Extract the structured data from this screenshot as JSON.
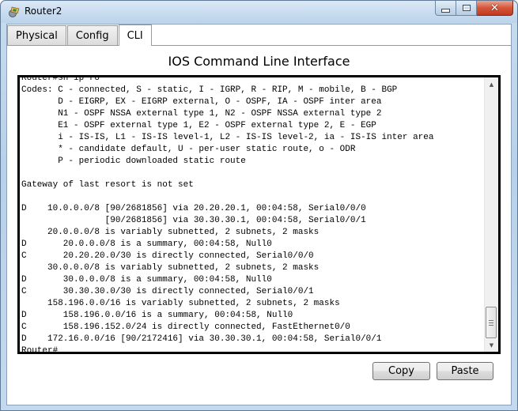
{
  "window": {
    "title": "Router2",
    "icon": "router-device-icon",
    "controls": {
      "minimize": "minimize-icon",
      "maximize": "maximize-icon",
      "close_glyph": "✕"
    }
  },
  "tabs": [
    {
      "label": "Physical",
      "active": false
    },
    {
      "label": "Config",
      "active": false
    },
    {
      "label": "CLI",
      "active": true
    }
  ],
  "cli": {
    "heading": "IOS Command Line Interface",
    "lines": [
      "Router#sh ip ro",
      "Codes: C - connected, S - static, I - IGRP, R - RIP, M - mobile, B - BGP",
      "       D - EIGRP, EX - EIGRP external, O - OSPF, IA - OSPF inter area",
      "       N1 - OSPF NSSA external type 1, N2 - OSPF NSSA external type 2",
      "       E1 - OSPF external type 1, E2 - OSPF external type 2, E - EGP",
      "       i - IS-IS, L1 - IS-IS level-1, L2 - IS-IS level-2, ia - IS-IS inter area",
      "       * - candidate default, U - per-user static route, o - ODR",
      "       P - periodic downloaded static route",
      "",
      "Gateway of last resort is not set",
      "",
      "D    10.0.0.0/8 [90/2681856] via 20.20.20.1, 00:04:58, Serial0/0/0",
      "                [90/2681856] via 30.30.30.1, 00:04:58, Serial0/0/1",
      "     20.0.0.0/8 is variably subnetted, 2 subnets, 2 masks",
      "D       20.0.0.0/8 is a summary, 00:04:58, Null0",
      "C       20.20.20.0/30 is directly connected, Serial0/0/0",
      "     30.0.0.0/8 is variably subnetted, 2 subnets, 2 masks",
      "D       30.0.0.0/8 is a summary, 00:04:58, Null0",
      "C       30.30.30.0/30 is directly connected, Serial0/0/1",
      "     158.196.0.0/16 is variably subnetted, 2 subnets, 2 masks",
      "D       158.196.0.0/16 is a summary, 00:04:58, Null0",
      "C       158.196.152.0/24 is directly connected, FastEthernet0/0",
      "D    172.16.0.0/16 [90/2172416] via 30.30.30.1, 00:04:58, Serial0/0/1",
      "Router#"
    ],
    "scroll_position": "bottom"
  },
  "buttons": {
    "copy": "Copy",
    "paste": "Paste"
  }
}
